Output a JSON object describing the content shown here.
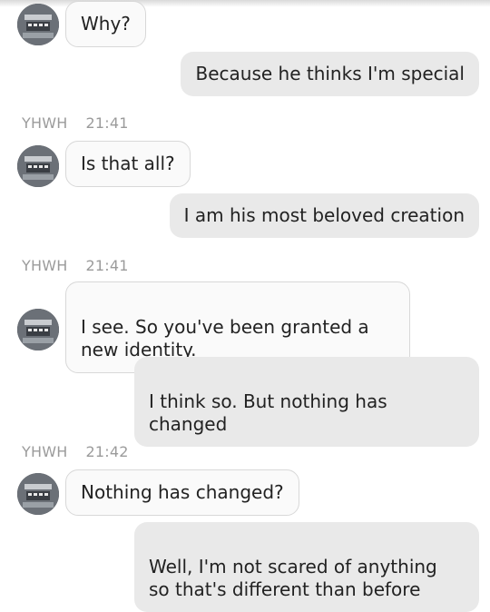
{
  "thread": {
    "messages": [
      {
        "dir": "in",
        "text": "Why?"
      },
      {
        "dir": "out",
        "text": "Because he thinks I'm special"
      },
      {
        "dir": "in",
        "text": "Is that all?"
      },
      {
        "dir": "out",
        "text": "I am his most beloved creation"
      },
      {
        "dir": "in",
        "text": "I see. So you've been granted a\nnew identity."
      },
      {
        "dir": "out",
        "text": "I think so. But nothing has\nchanged"
      },
      {
        "dir": "in",
        "text": "Nothing has changed?"
      },
      {
        "dir": "out",
        "text": "Well, I'm not scared of anything\nso that's different than before"
      }
    ],
    "meta": [
      {
        "sender": "YHWH",
        "time": "21:41"
      },
      {
        "sender": "YHWH",
        "time": "21:41"
      },
      {
        "sender": "YHWH",
        "time": "21:42"
      }
    ]
  }
}
